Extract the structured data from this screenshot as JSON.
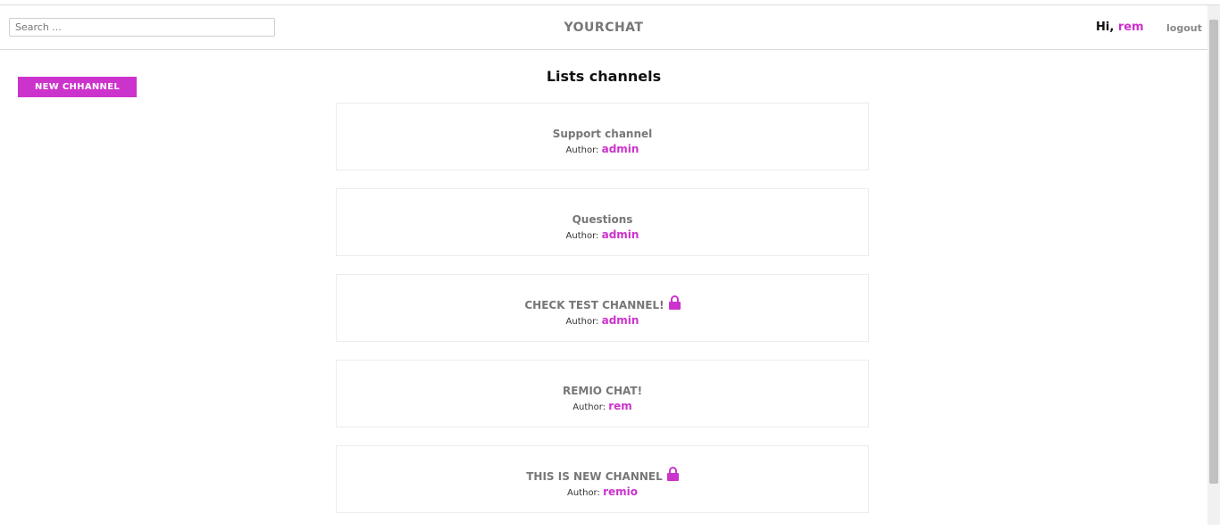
{
  "header": {
    "search_placeholder": "Search ...",
    "brand": "YOURCHAT",
    "greeting": "Hi,",
    "username": "rem",
    "logout_label": "logout"
  },
  "sidebar": {
    "new_channel_label": "NEW CHHANNEL"
  },
  "main": {
    "title": "Lists channels",
    "author_label": "Author:",
    "channels": [
      {
        "name": "Support channel",
        "author": "admin",
        "locked": false
      },
      {
        "name": "Questions",
        "author": "admin",
        "locked": false
      },
      {
        "name": "CHECK TEST CHANNEL!",
        "author": "admin",
        "locked": true
      },
      {
        "name": "REMIO CHAT!",
        "author": "rem",
        "locked": false
      },
      {
        "name": "THIS IS NEW CHANNEL",
        "author": "remio",
        "locked": true
      }
    ]
  },
  "colors": {
    "accent": "#cc33cc",
    "muted": "#777777"
  },
  "icons": {
    "locked": "lock-icon"
  }
}
